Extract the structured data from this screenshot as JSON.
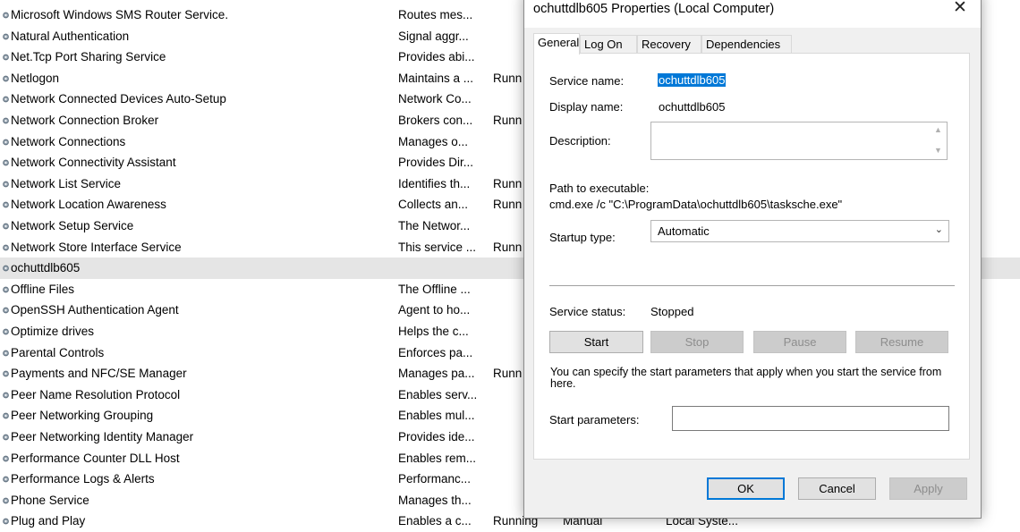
{
  "colors": {
    "selection": "#0078d7",
    "row_highlight": "#e5e5e5",
    "dialog_bg": "#f0f0f0"
  },
  "services": [
    {
      "name": "Microsoft Windows SMS Router Service.",
      "desc": "Routes mes...",
      "status": "",
      "startup": "",
      "logon": ""
    },
    {
      "name": "Natural Authentication",
      "desc": "Signal aggr...",
      "status": "",
      "startup": "",
      "logon": ""
    },
    {
      "name": "Net.Tcp Port Sharing Service",
      "desc": "Provides abi...",
      "status": "",
      "startup": "",
      "logon": ""
    },
    {
      "name": "Netlogon",
      "desc": "Maintains a ...",
      "status": "Runn",
      "startup": "",
      "logon": ""
    },
    {
      "name": "Network Connected Devices Auto-Setup",
      "desc": "Network Co...",
      "status": "",
      "startup": "",
      "logon": ""
    },
    {
      "name": "Network Connection Broker",
      "desc": "Brokers con...",
      "status": "Runn",
      "startup": "",
      "logon": ""
    },
    {
      "name": "Network Connections",
      "desc": "Manages o...",
      "status": "",
      "startup": "",
      "logon": ""
    },
    {
      "name": "Network Connectivity Assistant",
      "desc": "Provides Dir...",
      "status": "",
      "startup": "",
      "logon": ""
    },
    {
      "name": "Network List Service",
      "desc": "Identifies th...",
      "status": "Runn",
      "startup": "",
      "logon": ""
    },
    {
      "name": "Network Location Awareness",
      "desc": "Collects an...",
      "status": "Runn",
      "startup": "",
      "logon": ""
    },
    {
      "name": "Network Setup Service",
      "desc": "The Networ...",
      "status": "",
      "startup": "",
      "logon": ""
    },
    {
      "name": "Network Store Interface Service",
      "desc": "This service ...",
      "status": "Runn",
      "startup": "",
      "logon": ""
    },
    {
      "name": "ochuttdlb605",
      "desc": "",
      "status": "",
      "startup": "",
      "logon": "",
      "selected": true
    },
    {
      "name": "Offline Files",
      "desc": "The Offline ...",
      "status": "",
      "startup": "",
      "logon": ""
    },
    {
      "name": "OpenSSH Authentication Agent",
      "desc": "Agent to ho...",
      "status": "",
      "startup": "",
      "logon": ""
    },
    {
      "name": "Optimize drives",
      "desc": "Helps the c...",
      "status": "",
      "startup": "",
      "logon": ""
    },
    {
      "name": "Parental Controls",
      "desc": "Enforces pa...",
      "status": "",
      "startup": "",
      "logon": ""
    },
    {
      "name": "Payments and NFC/SE Manager",
      "desc": "Manages pa...",
      "status": "Runn",
      "startup": "",
      "logon": ""
    },
    {
      "name": "Peer Name Resolution Protocol",
      "desc": "Enables serv...",
      "status": "",
      "startup": "",
      "logon": ""
    },
    {
      "name": "Peer Networking Grouping",
      "desc": "Enables mul...",
      "status": "",
      "startup": "",
      "logon": ""
    },
    {
      "name": "Peer Networking Identity Manager",
      "desc": "Provides ide...",
      "status": "",
      "startup": "",
      "logon": ""
    },
    {
      "name": "Performance Counter DLL Host",
      "desc": "Enables rem...",
      "status": "",
      "startup": "",
      "logon": ""
    },
    {
      "name": "Performance Logs & Alerts",
      "desc": "Performanc...",
      "status": "",
      "startup": "",
      "logon": ""
    },
    {
      "name": "Phone Service",
      "desc": "Manages th...",
      "status": "",
      "startup": "",
      "logon": ""
    },
    {
      "name": "Plug and Play",
      "desc": "Enables a c...",
      "status": "Running",
      "startup": "Manual",
      "logon": "Local Syste..."
    }
  ],
  "dialog": {
    "title": "ochuttdlb605 Properties (Local Computer)",
    "close_glyph": "✕",
    "tabs": [
      "General",
      "Log On",
      "Recovery",
      "Dependencies"
    ],
    "service_name_label": "Service name:",
    "service_name": "ochuttdlb605",
    "display_name_label": "Display name:",
    "display_name": "ochuttdlb605",
    "description_label": "Description:",
    "path_label": "Path to executable:",
    "path": "cmd.exe /c \"C:\\ProgramData\\ochuttdlb605\\tasksche.exe\"",
    "startup_type_label": "Startup type:",
    "startup_type": "Automatic",
    "service_status_label": "Service status:",
    "service_status": "Stopped",
    "buttons": {
      "start": "Start",
      "stop": "Stop",
      "pause": "Pause",
      "resume": "Resume"
    },
    "hint": "You can specify the start parameters that apply when you start the service from here.",
    "start_params_label": "Start parameters:",
    "start_params_value": "",
    "ok": "OK",
    "cancel": "Cancel",
    "apply": "Apply"
  }
}
